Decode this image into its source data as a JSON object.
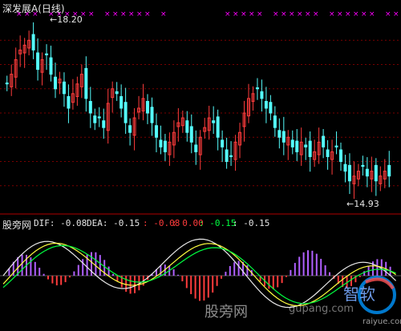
{
  "header": {
    "title": "深发展A(日线)"
  },
  "price_panel": {
    "high_label": "18.20",
    "low_label": "14.93",
    "ylim": [
      14.5,
      18.6
    ],
    "gridlines": [
      18.0,
      17.5,
      17.0,
      16.5,
      16.0,
      15.5,
      15.0
    ],
    "colors": {
      "up": "#ff3c3c",
      "down": "#54fcfc",
      "grid": "#7a0000",
      "marker": "#ff00ff"
    }
  },
  "macd_panel": {
    "panel_title": "股旁网",
    "dif_label": "DIF: -0.08",
    "dea_label": "DEA: -0.15",
    "v1": ": -0.08",
    "v2": ": 0.00",
    "v3": ": -0.15",
    "v4": ": -0.15",
    "colors": {
      "dif": "#e8e8e8",
      "dea": "#ffff40",
      "signal": "#00ff40",
      "pos_bar": "#ff3c3c",
      "neg_bar": "#b060ff"
    }
  },
  "watermark": {
    "text": "股旁网",
    "url": "gupang.com",
    "logo_text": "智软",
    "logo_url": "raiyue.com"
  },
  "chart_data": {
    "type": "candlestick",
    "title": "深发展A(日线)",
    "ylim": [
      14.5,
      18.6
    ],
    "high_marker": 18.2,
    "low_marker": 14.93,
    "closes": [
      17.1,
      17.3,
      17.6,
      17.8,
      17.9,
      18.0,
      17.8,
      17.4,
      17.6,
      17.7,
      17.3,
      17.0,
      17.2,
      16.9,
      16.6,
      16.9,
      17.1,
      17.3,
      16.8,
      16.5,
      16.3,
      16.4,
      16.2,
      16.7,
      17.0,
      16.9,
      16.6,
      16.3,
      16.1,
      16.4,
      16.6,
      16.8,
      16.5,
      16.3,
      16.0,
      15.8,
      15.7,
      15.9,
      16.1,
      16.3,
      16.4,
      16.1,
      15.9,
      15.7,
      16.0,
      16.2,
      16.4,
      16.3,
      16.0,
      15.8,
      15.5,
      15.6,
      15.9,
      16.1,
      16.5,
      16.8,
      16.9,
      17.0,
      16.8,
      16.6,
      16.5,
      16.2,
      16.0,
      15.9,
      16.0,
      15.8,
      15.7,
      15.9,
      15.8,
      15.6,
      15.7,
      15.9,
      15.8,
      15.6,
      15.7,
      15.8,
      15.5,
      15.3,
      15.1,
      15.2,
      15.3,
      15.4,
      15.2,
      15.3,
      15.1,
      15.2,
      15.3,
      15.2
    ],
    "macd": {
      "dif_label": "DIF",
      "dea_label": "DEA",
      "dif_value": -0.08,
      "dea_value": -0.15
    }
  }
}
